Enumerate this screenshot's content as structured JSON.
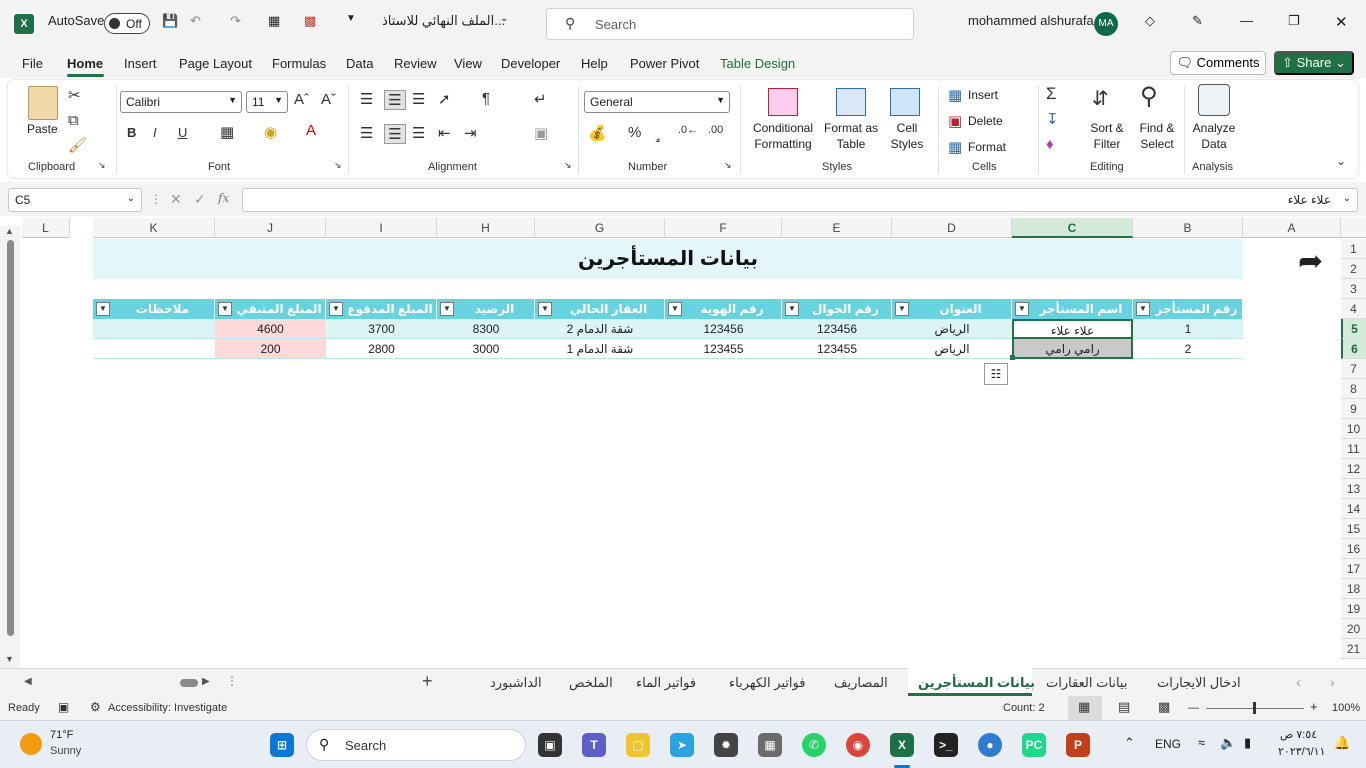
{
  "titlebar": {
    "autosave_label": "AutoSave",
    "autosave_state": "Off",
    "filename": "الملف النهائي للاستاذ...",
    "search_placeholder": "Search",
    "user_name": "mohammed alshurafa",
    "user_initials": "MA"
  },
  "menu": {
    "items": [
      "File",
      "Home",
      "Insert",
      "Page Layout",
      "Formulas",
      "Data",
      "Review",
      "View",
      "Developer",
      "Help",
      "Power Pivot",
      "Table Design"
    ],
    "active": "Home",
    "comments_label": "Comments",
    "share_label": "Share"
  },
  "ribbon": {
    "clipboard": {
      "paste_label": "Paste",
      "group_label": "Clipboard"
    },
    "font": {
      "font_name": "Calibri",
      "font_size": "11",
      "bold": "B",
      "italic": "I",
      "underline": "U",
      "group_label": "Font"
    },
    "alignment": {
      "group_label": "Alignment"
    },
    "number": {
      "format": "General",
      "group_label": "Number"
    },
    "styles": {
      "conditional_formatting": "Conditional Formatting",
      "format_as_table": "Format as Table",
      "cell_styles": "Cell Styles",
      "group_label": "Styles"
    },
    "cells": {
      "insert": "Insert",
      "delete": "Delete",
      "format": "Format",
      "group_label": "Cells"
    },
    "editing": {
      "sort_filter": "Sort & Filter",
      "find_select": "Find & Select",
      "group_label": "Editing"
    },
    "analysis": {
      "analyze_data": "Analyze Data",
      "group_label": "Analysis"
    }
  },
  "formula_bar": {
    "name_box": "C5",
    "fx": "fx",
    "content": "علاء علاء"
  },
  "grid": {
    "columns": [
      "L",
      "K",
      "J",
      "I",
      "H",
      "G",
      "F",
      "E",
      "D",
      "C",
      "B",
      "A"
    ],
    "selected_column": "C",
    "rows": [
      "1",
      "2",
      "3",
      "4",
      "5",
      "6",
      "7",
      "8",
      "9",
      "10",
      "11",
      "12",
      "13",
      "14",
      "15",
      "16",
      "17",
      "18",
      "19",
      "20",
      "21"
    ],
    "selected_rows": [
      "5",
      "6"
    ],
    "sheet_title": "بيانات المستأجرين",
    "table_headers": [
      "رقم المستأجر",
      "اسم المستأجر",
      "العنوان",
      "رقم الجوال",
      "رقم الهوية",
      "العقار الحالي",
      "الرصيد",
      "المبلغ المدفوع",
      "المبلغ المتبقي",
      "ملاحظات"
    ],
    "table_rows": [
      [
        "1",
        "علاء علاء",
        "الرياض",
        "123456",
        "123456",
        "شقة الدمام 2",
        "8300",
        "3700",
        "4600",
        ""
      ],
      [
        "2",
        "رامي رامي",
        "الرياض",
        "123455",
        "123455",
        "شقة الدمام 1",
        "3000",
        "2800",
        "200",
        ""
      ]
    ]
  },
  "sheet_tabs": {
    "tabs": [
      "ادخال الايجارات",
      "بيانات العقارات",
      "بيانات المستأجرين",
      "المصاريف",
      "فواتير الكهرباء",
      "فواتير الماء",
      "الملخص",
      "الداشبورد"
    ],
    "active": "بيانات المستأجرين"
  },
  "status": {
    "ready": "Ready",
    "accessibility": "Accessibility: Investigate",
    "count": "Count: 2",
    "zoom": "100%"
  },
  "taskbar": {
    "weather_temp": "71°F",
    "weather_desc": "Sunny",
    "search_label": "Search",
    "language": "ENG",
    "time": "٧:٥٤ ص",
    "date": "٢٠٢٣/٦/١١"
  },
  "colors": {
    "excel_green": "#217346",
    "table_header": "#67d3e0",
    "table_band": "#ddf4f7",
    "highlight_pink": "#fdd9d9"
  }
}
